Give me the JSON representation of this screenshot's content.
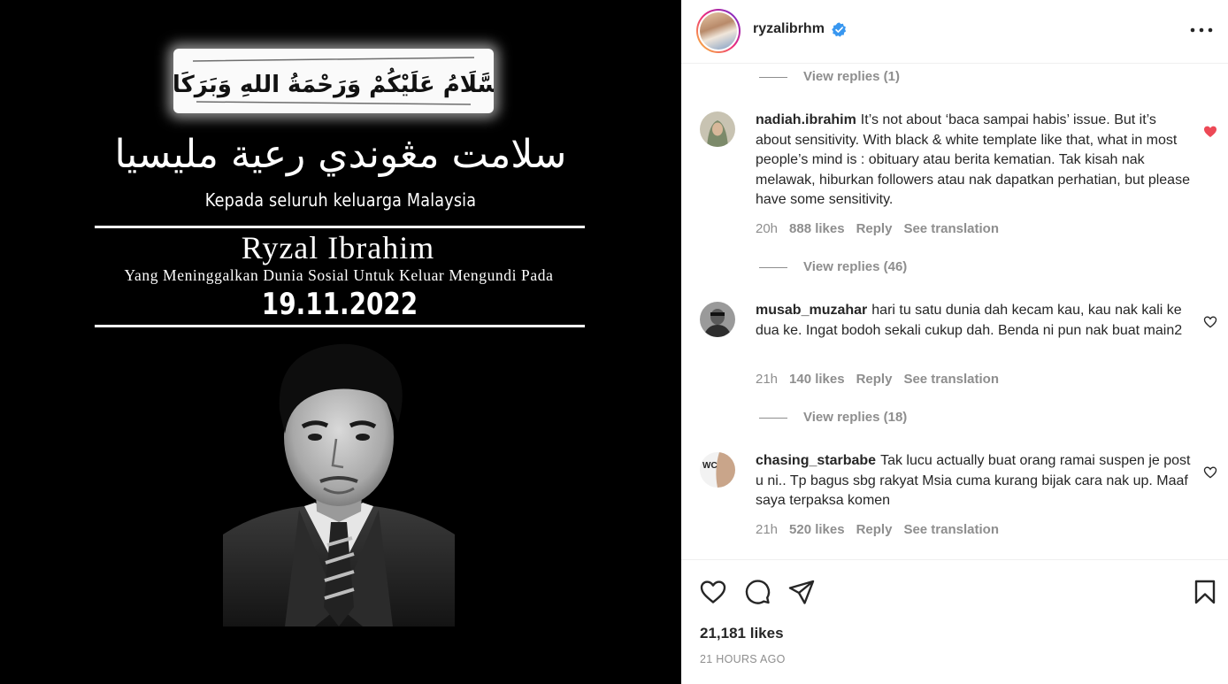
{
  "image": {
    "calligraphy_text": "السَّلَامُ عَلَيْكُمْ وَرَحْمَةُ اللهِ وَبَرَكَاتُهُ",
    "jawi_line": "سلامت مڠوندي رعية مليسيا",
    "subtitle": "Kepada seluruh keluarga Malaysia",
    "name": "Ryzal Ibrahim",
    "tagline": "Yang Meninggalkan Dunia Sosial Untuk Keluar Mengundi Pada",
    "date": "19.11.2022"
  },
  "header": {
    "username": "ryzalibrhm",
    "verified_icon": "verified-badge-icon",
    "more_icon": "more-options-icon"
  },
  "replies": [
    {
      "label": "View replies (1)"
    },
    {
      "label": "View replies (46)"
    },
    {
      "label": "View replies (18)"
    }
  ],
  "comments": [
    {
      "username": "nadiah.ibrahim",
      "text": "It’s not about ‘baca sampai habis’ issue. But it’s about sensitivity. With black & white template like that, what in most people’s mind is : obituary atau berita kematian. Tak kisah nak melawak, hiburkan followers atau nak dapatkan perhatian, but please have some sensitivity.",
      "time": "20h",
      "likes": "888 likes",
      "reply": "Reply",
      "translate": "See translation",
      "liked": true
    },
    {
      "username": "musab_muzahar",
      "text": "hari tu satu dunia dah kecam kau, kau nak kali ke dua ke. Ingat bodoh sekali cukup dah. Benda ni pun nak buat main2",
      "time": "21h",
      "likes": "140 likes",
      "reply": "Reply",
      "translate": "See translation",
      "liked": false
    },
    {
      "username": "chasing_starbabe",
      "text": "Tak lucu actually buat orang ramai suspen je post u ni.. Tp bagus sbg rakyat Msia cuma kurang bijak cara nak up. Maaf saya terpaksa komen",
      "time": "21h",
      "likes": "520 likes",
      "reply": "Reply",
      "translate": "See translation",
      "liked": false,
      "avatar_text": "WC"
    }
  ],
  "actions": {
    "icons": [
      "heart-icon",
      "comment-icon",
      "share-icon",
      "bookmark-icon"
    ],
    "likes": "21,181 likes",
    "timestamp": "21 HOURS AGO"
  },
  "colors": {
    "liked_heart": "#ed4956",
    "verified": "#3897f0",
    "muted_text": "#8e8e8e",
    "primary_text": "#262626"
  }
}
